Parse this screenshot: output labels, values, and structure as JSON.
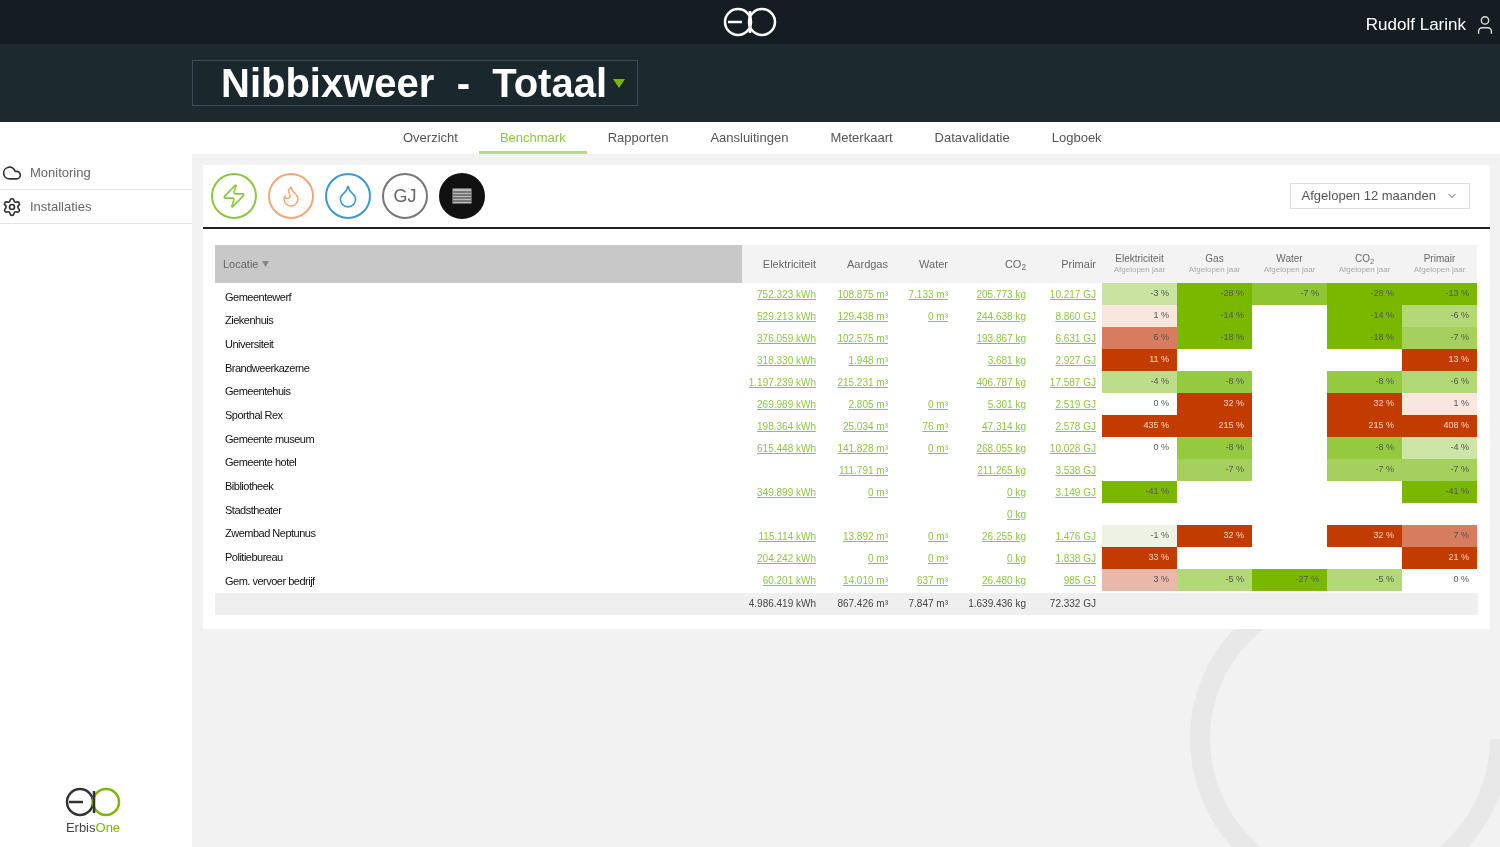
{
  "header": {
    "user": "Rudolf Larink",
    "title": "Nibbixweer  -  Totaal"
  },
  "tabs": [
    {
      "label": "Overzicht",
      "selected": false
    },
    {
      "label": "Benchmark",
      "selected": true
    },
    {
      "label": "Rapporten",
      "selected": false
    },
    {
      "label": "Aansluitingen",
      "selected": false
    },
    {
      "label": "Meterkaart",
      "selected": false
    },
    {
      "label": "Datavalidatie",
      "selected": false
    },
    {
      "label": "Logboek",
      "selected": false
    }
  ],
  "sidebar": {
    "items": [
      {
        "label": "Monitoring",
        "kind": "monitoring"
      },
      {
        "label": "Installaties",
        "kind": "installations"
      }
    ],
    "logo_text": "Erbis",
    "logo_text_accent": "One"
  },
  "energy_buttons": [
    {
      "kind": "electricity",
      "selected": false
    },
    {
      "kind": "gas",
      "selected": false
    },
    {
      "kind": "water",
      "selected": false
    },
    {
      "kind": "gj",
      "label": "GJ",
      "selected": false
    },
    {
      "kind": "table",
      "selected": true
    }
  ],
  "period_select": {
    "value": "Afgelopen 12 maanden"
  },
  "table": {
    "location_header": "Locatie",
    "value_columns": [
      "Elektriciteit",
      "Aardgas",
      "Water",
      "CO$_{2}$",
      "Primair"
    ],
    "pct_columns": [
      {
        "title": "Elektriciteit",
        "subtitle": "Afgelopen jaar"
      },
      {
        "title": "Gas",
        "subtitle": "Afgelopen jaar"
      },
      {
        "title": "Water",
        "subtitle": "Afgelopen jaar"
      },
      {
        "title": "CO$_{2}$",
        "subtitle": "Afgelopen jaar"
      },
      {
        "title": "Primair",
        "subtitle": "Afgelopen jaar"
      }
    ],
    "locations": [
      "Gemeentewerf",
      "Ziekenhuis",
      "Universiteit",
      "Brandweerkazerne",
      "Gemeentehuis",
      "Sporthal Rex",
      "Gemeente museum",
      "Gemeente hotel",
      "Bibliotheek",
      "Stadstheater",
      "Zwembad Neptunus",
      "Politiebureau",
      "Gem. vervoer bedrijf"
    ],
    "rows": [
      {
        "values": {
          "elektriciteit": "752.323 kWh",
          "aardgas": "108.875 m³",
          "water": "7.133 m³",
          "co2": "205.773 kg",
          "primair": "10.217 GJ"
        },
        "pct": {
          "elektriciteit": {
            "value": "-3 %",
            "color": "#c9e3a0"
          },
          "gas": {
            "value": "-28 %",
            "color": "#7ab800"
          },
          "water": {
            "value": "-7 %",
            "color": "#8fc530"
          },
          "co2": {
            "value": "-28 %",
            "color": "#7ab800"
          },
          "primair": {
            "value": "-13 %",
            "color": "#7ab800"
          }
        }
      },
      {
        "values": {
          "elektriciteit": "529.213 kWh",
          "aardgas": "129.438 m³",
          "water": "0 m³",
          "co2": "244.638 kg",
          "primair": "8.860 GJ"
        },
        "pct": {
          "elektriciteit": {
            "value": "1 %",
            "color": "#f8e6df"
          },
          "gas": {
            "value": "-14 %",
            "color": "#7ab800"
          },
          "co2": {
            "value": "-14 %",
            "color": "#7ab800"
          },
          "primair": {
            "value": "-6 %",
            "color": "#b3d877"
          }
        }
      },
      {
        "values": {
          "elektriciteit": "376.059 kWh",
          "aardgas": "102.575 m³",
          "co2": "193.867 kg",
          "primair": "6.631 GJ"
        },
        "pct": {
          "elektriciteit": {
            "value": "6 %",
            "color": "#d77c5e"
          },
          "gas": {
            "value": "-18 %",
            "color": "#7ab800"
          },
          "co2": {
            "value": "-18 %",
            "color": "#7ab800"
          },
          "primair": {
            "value": "-7 %",
            "color": "#a6d05e"
          }
        }
      },
      {
        "values": {
          "elektriciteit": "318.330 kWh",
          "aardgas": "1.948 m³",
          "co2": "3.681 kg",
          "primair": "2.927 GJ"
        },
        "pct": {
          "elektriciteit": {
            "value": "11 %",
            "color": "#c23b00"
          },
          "primair": {
            "value": "13 %",
            "color": "#c23b00"
          }
        }
      },
      {
        "values": {
          "elektriciteit": "1.197.239 kWh",
          "aardgas": "215.231 m³",
          "co2": "406.787 kg",
          "primair": "17.587 GJ"
        },
        "pct": {
          "elektriciteit": {
            "value": "-4 %",
            "color": "#bedd8a"
          },
          "gas": {
            "value": "-8 %",
            "color": "#95c940"
          },
          "co2": {
            "value": "-8 %",
            "color": "#95c940"
          },
          "primair": {
            "value": "-6 %",
            "color": "#b3d877"
          }
        }
      },
      {
        "values": {
          "elektriciteit": "269.989 kWh",
          "aardgas": "2.805 m³",
          "water": "0 m³",
          "co2": "5.301 kg",
          "primair": "2.519 GJ"
        },
        "pct": {
          "elektriciteit": {
            "value": "0 %",
            "color": "#ffffff"
          },
          "gas": {
            "value": "32 %",
            "color": "#c23b00"
          },
          "co2": {
            "value": "32 %",
            "color": "#c23b00"
          },
          "primair": {
            "value": "1 %",
            "color": "#f8e6df"
          }
        }
      },
      {
        "values": {
          "elektriciteit": "198.364 kWh",
          "aardgas": "25.034 m³",
          "water": "76 m³",
          "co2": "47.314 kg",
          "primair": "2.578 GJ"
        },
        "pct": {
          "elektriciteit": {
            "value": "435 %",
            "color": "#c23b00"
          },
          "gas": {
            "value": "215 %",
            "color": "#c23b00"
          },
          "co2": {
            "value": "215 %",
            "color": "#c23b00"
          },
          "primair": {
            "value": "408 %",
            "color": "#c23b00"
          }
        }
      },
      {
        "values": {
          "elektriciteit": "615.448 kWh",
          "aardgas": "141.828 m³",
          "water": "0 m³",
          "co2": "268.055 kg",
          "primair": "10.028 GJ"
        },
        "pct": {
          "elektriciteit": {
            "value": "0 %",
            "color": "#ffffff"
          },
          "gas": {
            "value": "-8 %",
            "color": "#95c940"
          },
          "co2": {
            "value": "-8 %",
            "color": "#95c940"
          },
          "primair": {
            "value": "-4 %",
            "color": "#cde5a6"
          }
        }
      },
      {
        "values": {
          "aardgas": "111.791 m³",
          "co2": "211.265 kg",
          "primair": "3.538 GJ"
        },
        "pct": {
          "gas": {
            "value": "-7 %",
            "color": "#a6d05e"
          },
          "co2": {
            "value": "-7 %",
            "color": "#a6d05e"
          },
          "primair": {
            "value": "-7 %",
            "color": "#a6d05e"
          }
        }
      },
      {
        "values": {
          "elektriciteit": "349.899 kWh",
          "aardgas": "0 m³",
          "co2": "0 kg",
          "primair": "3.149 GJ"
        },
        "pct": {
          "elektriciteit": {
            "value": "-41 %",
            "color": "#7ab800"
          },
          "primair": {
            "value": "-41 %",
            "color": "#7ab800"
          }
        }
      },
      {
        "values": {
          "co2": "0 kg"
        }
      },
      {
        "values": {
          "elektriciteit": "115.114 kWh",
          "aardgas": "13.892 m³",
          "water": "0 m³",
          "co2": "26.255 kg",
          "primair": "1.476 GJ"
        },
        "pct": {
          "elektriciteit": {
            "value": "-1 %",
            "color": "#eef2e4"
          },
          "gas": {
            "value": "32 %",
            "color": "#c23b00"
          },
          "co2": {
            "value": "32 %",
            "color": "#c23b00"
          },
          "primair": {
            "value": "7 %",
            "color": "#d77c5e"
          }
        }
      },
      {
        "values": {
          "elektriciteit": "204.242 kWh",
          "aardgas": "0 m³",
          "water": "0 m³",
          "co2": "0 kg",
          "primair": "1.838 GJ"
        },
        "pct": {
          "elektriciteit": {
            "value": "33 %",
            "color": "#c23b00"
          },
          "primair": {
            "value": "21 %",
            "color": "#c23b00"
          }
        }
      },
      {
        "values": {
          "elektriciteit": "60.201 kWh",
          "aardgas": "14.010 m³",
          "water": "637 m³",
          "co2": "26.480 kg",
          "primair": "985 GJ"
        },
        "pct": {
          "elektriciteit": {
            "value": "3 %",
            "color": "#e9b8a8"
          },
          "gas": {
            "value": "-5 %",
            "color": "#b3d877"
          },
          "water": {
            "value": "-27 %",
            "color": "#7ab800"
          },
          "co2": {
            "value": "-5 %",
            "color": "#b3d877"
          },
          "primair": {
            "value": "0 %",
            "color": "#ffffff"
          }
        }
      }
    ],
    "totals": {
      "elektriciteit": "4.986.419 kWh",
      "aardgas": "867.426 m³",
      "water": "7.847 m³",
      "co2": "1.639.436 kg",
      "primair": "72.332 GJ"
    }
  }
}
